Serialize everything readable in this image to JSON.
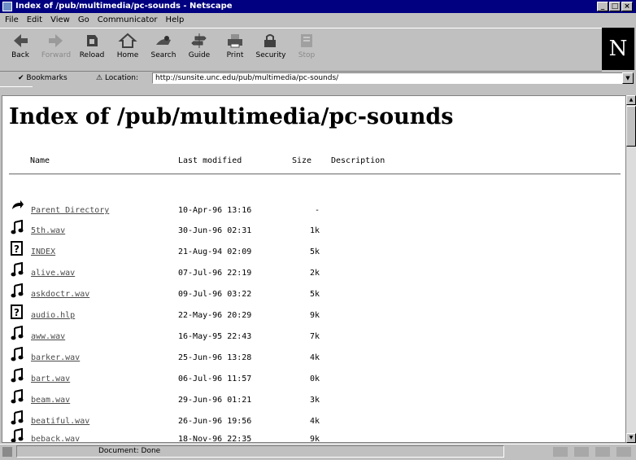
{
  "window": {
    "title": "Index of /pub/multimedia/pc-sounds - Netscape",
    "min": "_",
    "max": "□",
    "close": "×"
  },
  "menu": [
    "File",
    "Edit",
    "View",
    "Go",
    "Communicator",
    "Help"
  ],
  "toolbar": {
    "buttons": [
      {
        "label": "Back",
        "icon": "back-arrow-icon"
      },
      {
        "label": "Forward",
        "icon": "forward-arrow-icon"
      },
      {
        "label": "Reload",
        "icon": "reload-icon"
      },
      {
        "label": "Home",
        "icon": "home-icon"
      },
      {
        "label": "Search",
        "icon": "search-icon"
      },
      {
        "label": "Guide",
        "icon": "guide-icon"
      },
      {
        "label": "Print",
        "icon": "print-icon"
      },
      {
        "label": "Security",
        "icon": "security-icon"
      },
      {
        "label": "Stop",
        "icon": "stop-icon"
      }
    ],
    "logo": "N"
  },
  "location": {
    "bookmarks_label": "Bookmarks",
    "location_label": "Location:",
    "url": "http://sunsite.unc.edu/pub/multimedia/pc-sounds/"
  },
  "page": {
    "heading": "Index of /pub/multimedia/pc-sounds",
    "columns": {
      "name": "Name",
      "modified": "Last modified",
      "size": "Size",
      "description": "Description"
    },
    "entries": [
      {
        "name": "Parent Directory",
        "modified": "10-Apr-96 13:16",
        "size": "-",
        "icon": "back-arrow-icon"
      },
      {
        "name": "5th.wav",
        "modified": "30-Jun-96 02:31",
        "size": "1k",
        "icon": "sound-file-icon"
      },
      {
        "name": "INDEX",
        "modified": "21-Aug-94 02:09",
        "size": "5k",
        "icon": "unknown-file-icon"
      },
      {
        "name": "alive.wav",
        "modified": "07-Jul-96 22:19",
        "size": "2k",
        "icon": "sound-file-icon"
      },
      {
        "name": "askdoctr.wav",
        "modified": "09-Jul-96 03:22",
        "size": "5k",
        "icon": "sound-file-icon"
      },
      {
        "name": "audio.hlp",
        "modified": "22-May-96 20:29",
        "size": "9k",
        "icon": "unknown-file-icon"
      },
      {
        "name": "aww.wav",
        "modified": "16-May-95 22:43",
        "size": "7k",
        "icon": "sound-file-icon"
      },
      {
        "name": "barker.wav",
        "modified": "25-Jun-96 13:28",
        "size": "4k",
        "icon": "sound-file-icon"
      },
      {
        "name": "bart.wav",
        "modified": "06-Jul-96 11:57",
        "size": "0k",
        "icon": "sound-file-icon"
      },
      {
        "name": "beam.wav",
        "modified": "29-Jun-96 01:21",
        "size": "3k",
        "icon": "sound-file-icon"
      },
      {
        "name": "beatiful.wav",
        "modified": "26-Jun-96 19:56",
        "size": "4k",
        "icon": "sound-file-icon"
      },
      {
        "name": "beback.wav",
        "modified": "18-Nov-96 22:35",
        "size": "9k",
        "icon": "sound-file-icon"
      }
    ]
  },
  "status": {
    "text": "Document: Done"
  }
}
